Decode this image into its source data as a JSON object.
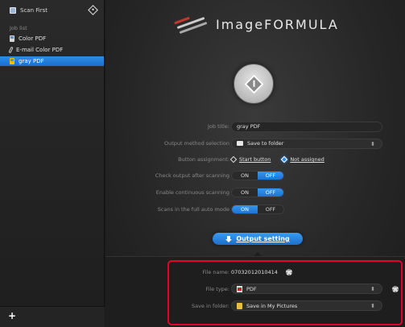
{
  "app": {
    "brand": "ImageFORMULA"
  },
  "sidebar": {
    "scan_first_label": "Scan First",
    "job_list_label": "Job list",
    "jobs": [
      {
        "label": "Color PDF",
        "selected": false,
        "icon": "document-icon"
      },
      {
        "label": "E-mail Color PDF",
        "selected": false,
        "icon": "paperclip-icon"
      },
      {
        "label": "gray PDF",
        "selected": true,
        "icon": "document-icon"
      }
    ],
    "add_label": "+"
  },
  "form": {
    "job_title_label": "Job title:",
    "job_title_value": "gray PDF",
    "output_method_label": "Output method selection",
    "output_method_value": "Save to folder",
    "button_assignment_label": "Button assignment:",
    "button_assignment_options": [
      "Start button",
      "Not assigned"
    ],
    "button_assignment_selected": "Not assigned",
    "check_output_label": "Check output after scanning",
    "check_output_on": "ON",
    "check_output_off": "OFF",
    "check_output_state": "OFF",
    "continuous_label": "Enable continuous scanning",
    "continuous_on": "ON",
    "continuous_off": "OFF",
    "continuous_state": "OFF",
    "full_auto_label": "Scans in the full auto mode",
    "full_auto_on": "ON",
    "full_auto_off": "OFF",
    "full_auto_state": "ON"
  },
  "output_setting_label": "Output setting",
  "output": {
    "file_name_label": "File name:",
    "file_name_value": "07032012010414",
    "file_type_label": "File type:",
    "file_type_value": "PDF",
    "save_folder_label": "Save in folder:",
    "save_folder_value": "Save in My Pictures"
  },
  "colors": {
    "accent": "#2f8ce6",
    "highlight": "#e4002b"
  }
}
